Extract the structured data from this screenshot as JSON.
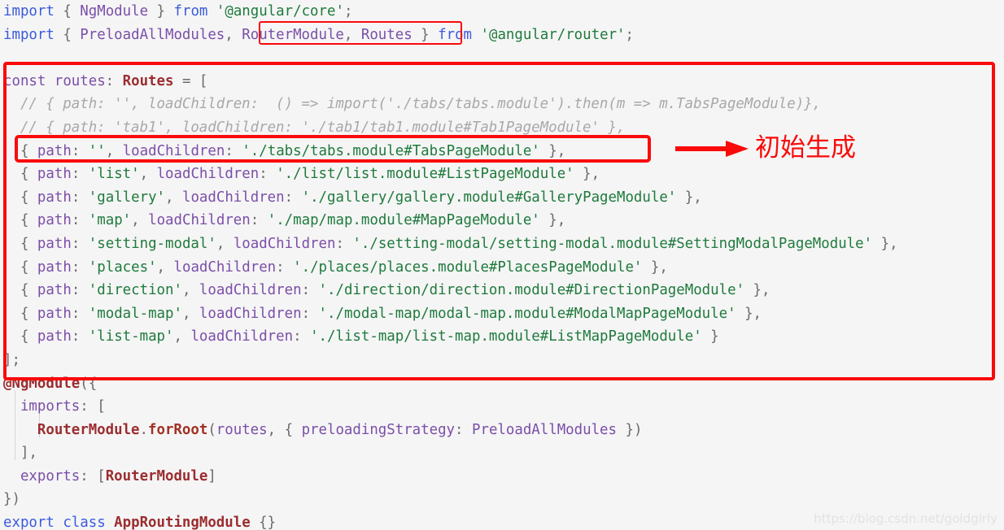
{
  "editor": {
    "language": "typescript",
    "background_color": "#f5f5f5",
    "lines": [
      {
        "n": 1,
        "tokens": [
          {
            "t": "import",
            "c": "kw"
          },
          {
            "t": " ",
            "c": "plain"
          },
          {
            "t": "{",
            "c": "punc"
          },
          {
            "t": " ",
            "c": "plain"
          },
          {
            "t": "NgModule",
            "c": "id"
          },
          {
            "t": " ",
            "c": "plain"
          },
          {
            "t": "}",
            "c": "punc"
          },
          {
            "t": " ",
            "c": "plain"
          },
          {
            "t": "from",
            "c": "kw"
          },
          {
            "t": " ",
            "c": "plain"
          },
          {
            "t": "'@angular/core'",
            "c": "str"
          },
          {
            "t": ";",
            "c": "punc"
          }
        ]
      },
      {
        "n": 2,
        "tokens": [
          {
            "t": "import",
            "c": "kw"
          },
          {
            "t": " ",
            "c": "plain"
          },
          {
            "t": "{",
            "c": "punc"
          },
          {
            "t": " ",
            "c": "plain"
          },
          {
            "t": "PreloadAllModules",
            "c": "id"
          },
          {
            "t": ",",
            "c": "punc"
          },
          {
            "t": " ",
            "c": "plain"
          },
          {
            "t": "RouterModule",
            "c": "id"
          },
          {
            "t": ",",
            "c": "punc"
          },
          {
            "t": " ",
            "c": "plain"
          },
          {
            "t": "Routes",
            "c": "id"
          },
          {
            "t": " ",
            "c": "plain"
          },
          {
            "t": "}",
            "c": "punc"
          },
          {
            "t": " ",
            "c": "plain"
          },
          {
            "t": "from",
            "c": "kw"
          },
          {
            "t": " ",
            "c": "plain"
          },
          {
            "t": "'@angular/router'",
            "c": "str"
          },
          {
            "t": ";",
            "c": "punc"
          }
        ]
      },
      {
        "n": 3,
        "tokens": []
      },
      {
        "n": 4,
        "tokens": [
          {
            "t": "const",
            "c": "id"
          },
          {
            "t": " ",
            "c": "plain"
          },
          {
            "t": "routes",
            "c": "id"
          },
          {
            "t": ":",
            "c": "punc"
          },
          {
            "t": " ",
            "c": "plain"
          },
          {
            "t": "Routes",
            "c": "type"
          },
          {
            "t": " ",
            "c": "plain"
          },
          {
            "t": "=",
            "c": "punc"
          },
          {
            "t": " ",
            "c": "plain"
          },
          {
            "t": "[",
            "c": "punc"
          }
        ]
      },
      {
        "n": 5,
        "tokens": [
          {
            "t": "  // { path: '', loadChildren:  () => import('./tabs/tabs.module').then(m => m.TabsPageModule)},",
            "c": "cmt"
          }
        ]
      },
      {
        "n": 6,
        "tokens": [
          {
            "t": "  // { path: 'tab1', loadChildren: './tab1/tab1.module#Tab1PageModule' },",
            "c": "cmt"
          }
        ]
      },
      {
        "n": 7,
        "tokens": [
          {
            "t": "  ",
            "c": "plain"
          },
          {
            "t": "{",
            "c": "punc"
          },
          {
            "t": " ",
            "c": "plain"
          },
          {
            "t": "path",
            "c": "id"
          },
          {
            "t": ":",
            "c": "punc"
          },
          {
            "t": " ",
            "c": "plain"
          },
          {
            "t": "''",
            "c": "str"
          },
          {
            "t": ",",
            "c": "punc"
          },
          {
            "t": " ",
            "c": "plain"
          },
          {
            "t": "loadChildren",
            "c": "id"
          },
          {
            "t": ":",
            "c": "punc"
          },
          {
            "t": " ",
            "c": "plain"
          },
          {
            "t": "'./tabs/tabs.module#TabsPageModule'",
            "c": "str"
          },
          {
            "t": " ",
            "c": "plain"
          },
          {
            "t": "}",
            "c": "punc"
          },
          {
            "t": ",",
            "c": "punc"
          }
        ]
      },
      {
        "n": 8,
        "tokens": [
          {
            "t": "  ",
            "c": "plain"
          },
          {
            "t": "{",
            "c": "punc"
          },
          {
            "t": " ",
            "c": "plain"
          },
          {
            "t": "path",
            "c": "id"
          },
          {
            "t": ":",
            "c": "punc"
          },
          {
            "t": " ",
            "c": "plain"
          },
          {
            "t": "'list'",
            "c": "str"
          },
          {
            "t": ",",
            "c": "punc"
          },
          {
            "t": " ",
            "c": "plain"
          },
          {
            "t": "loadChildren",
            "c": "id"
          },
          {
            "t": ":",
            "c": "punc"
          },
          {
            "t": " ",
            "c": "plain"
          },
          {
            "t": "'./list/list.module#ListPageModule'",
            "c": "str"
          },
          {
            "t": " ",
            "c": "plain"
          },
          {
            "t": "}",
            "c": "punc"
          },
          {
            "t": ",",
            "c": "punc"
          }
        ]
      },
      {
        "n": 9,
        "tokens": [
          {
            "t": "  ",
            "c": "plain"
          },
          {
            "t": "{",
            "c": "punc"
          },
          {
            "t": " ",
            "c": "plain"
          },
          {
            "t": "path",
            "c": "id"
          },
          {
            "t": ":",
            "c": "punc"
          },
          {
            "t": " ",
            "c": "plain"
          },
          {
            "t": "'gallery'",
            "c": "str"
          },
          {
            "t": ",",
            "c": "punc"
          },
          {
            "t": " ",
            "c": "plain"
          },
          {
            "t": "loadChildren",
            "c": "id"
          },
          {
            "t": ":",
            "c": "punc"
          },
          {
            "t": " ",
            "c": "plain"
          },
          {
            "t": "'./gallery/gallery.module#GalleryPageModule'",
            "c": "str"
          },
          {
            "t": " ",
            "c": "plain"
          },
          {
            "t": "}",
            "c": "punc"
          },
          {
            "t": ",",
            "c": "punc"
          }
        ]
      },
      {
        "n": 10,
        "tokens": [
          {
            "t": "  ",
            "c": "plain"
          },
          {
            "t": "{",
            "c": "punc"
          },
          {
            "t": " ",
            "c": "plain"
          },
          {
            "t": "path",
            "c": "id"
          },
          {
            "t": ":",
            "c": "punc"
          },
          {
            "t": " ",
            "c": "plain"
          },
          {
            "t": "'map'",
            "c": "str"
          },
          {
            "t": ",",
            "c": "punc"
          },
          {
            "t": " ",
            "c": "plain"
          },
          {
            "t": "loadChildren",
            "c": "id"
          },
          {
            "t": ":",
            "c": "punc"
          },
          {
            "t": " ",
            "c": "plain"
          },
          {
            "t": "'./map/map.module#MapPageModule'",
            "c": "str"
          },
          {
            "t": " ",
            "c": "plain"
          },
          {
            "t": "}",
            "c": "punc"
          },
          {
            "t": ",",
            "c": "punc"
          }
        ]
      },
      {
        "n": 11,
        "tokens": [
          {
            "t": "  ",
            "c": "plain"
          },
          {
            "t": "{",
            "c": "punc"
          },
          {
            "t": " ",
            "c": "plain"
          },
          {
            "t": "path",
            "c": "id"
          },
          {
            "t": ":",
            "c": "punc"
          },
          {
            "t": " ",
            "c": "plain"
          },
          {
            "t": "'setting-modal'",
            "c": "str"
          },
          {
            "t": ",",
            "c": "punc"
          },
          {
            "t": " ",
            "c": "plain"
          },
          {
            "t": "loadChildren",
            "c": "id"
          },
          {
            "t": ":",
            "c": "punc"
          },
          {
            "t": " ",
            "c": "plain"
          },
          {
            "t": "'./setting-modal/setting-modal.module#SettingModalPageModule'",
            "c": "str"
          },
          {
            "t": " ",
            "c": "plain"
          },
          {
            "t": "}",
            "c": "punc"
          },
          {
            "t": ",",
            "c": "punc"
          }
        ]
      },
      {
        "n": 12,
        "tokens": [
          {
            "t": "  ",
            "c": "plain"
          },
          {
            "t": "{",
            "c": "punc"
          },
          {
            "t": " ",
            "c": "plain"
          },
          {
            "t": "path",
            "c": "id"
          },
          {
            "t": ":",
            "c": "punc"
          },
          {
            "t": " ",
            "c": "plain"
          },
          {
            "t": "'places'",
            "c": "str"
          },
          {
            "t": ",",
            "c": "punc"
          },
          {
            "t": " ",
            "c": "plain"
          },
          {
            "t": "loadChildren",
            "c": "id"
          },
          {
            "t": ":",
            "c": "punc"
          },
          {
            "t": " ",
            "c": "plain"
          },
          {
            "t": "'./places/places.module#PlacesPageModule'",
            "c": "str"
          },
          {
            "t": " ",
            "c": "plain"
          },
          {
            "t": "}",
            "c": "punc"
          },
          {
            "t": ",",
            "c": "punc"
          }
        ]
      },
      {
        "n": 13,
        "tokens": [
          {
            "t": "  ",
            "c": "plain"
          },
          {
            "t": "{",
            "c": "punc"
          },
          {
            "t": " ",
            "c": "plain"
          },
          {
            "t": "path",
            "c": "id"
          },
          {
            "t": ":",
            "c": "punc"
          },
          {
            "t": " ",
            "c": "plain"
          },
          {
            "t": "'direction'",
            "c": "str"
          },
          {
            "t": ",",
            "c": "punc"
          },
          {
            "t": " ",
            "c": "plain"
          },
          {
            "t": "loadChildren",
            "c": "id"
          },
          {
            "t": ":",
            "c": "punc"
          },
          {
            "t": " ",
            "c": "plain"
          },
          {
            "t": "'./direction/direction.module#DirectionPageModule'",
            "c": "str"
          },
          {
            "t": " ",
            "c": "plain"
          },
          {
            "t": "}",
            "c": "punc"
          },
          {
            "t": ",",
            "c": "punc"
          }
        ]
      },
      {
        "n": 14,
        "tokens": [
          {
            "t": "  ",
            "c": "plain"
          },
          {
            "t": "{",
            "c": "punc"
          },
          {
            "t": " ",
            "c": "plain"
          },
          {
            "t": "path",
            "c": "id"
          },
          {
            "t": ":",
            "c": "punc"
          },
          {
            "t": " ",
            "c": "plain"
          },
          {
            "t": "'modal-map'",
            "c": "str"
          },
          {
            "t": ",",
            "c": "punc"
          },
          {
            "t": " ",
            "c": "plain"
          },
          {
            "t": "loadChildren",
            "c": "id"
          },
          {
            "t": ":",
            "c": "punc"
          },
          {
            "t": " ",
            "c": "plain"
          },
          {
            "t": "'./modal-map/modal-map.module#ModalMapPageModule'",
            "c": "str"
          },
          {
            "t": " ",
            "c": "plain"
          },
          {
            "t": "}",
            "c": "punc"
          },
          {
            "t": ",",
            "c": "punc"
          }
        ]
      },
      {
        "n": 15,
        "tokens": [
          {
            "t": "  ",
            "c": "plain"
          },
          {
            "t": "{",
            "c": "punc"
          },
          {
            "t": " ",
            "c": "plain"
          },
          {
            "t": "path",
            "c": "id"
          },
          {
            "t": ":",
            "c": "punc"
          },
          {
            "t": " ",
            "c": "plain"
          },
          {
            "t": "'list-map'",
            "c": "str"
          },
          {
            "t": ",",
            "c": "punc"
          },
          {
            "t": " ",
            "c": "plain"
          },
          {
            "t": "loadChildren",
            "c": "id"
          },
          {
            "t": ":",
            "c": "punc"
          },
          {
            "t": " ",
            "c": "plain"
          },
          {
            "t": "'./list-map/list-map.module#ListMapPageModule'",
            "c": "str"
          },
          {
            "t": " ",
            "c": "plain"
          },
          {
            "t": "}",
            "c": "punc"
          }
        ]
      },
      {
        "n": 16,
        "tokens": [
          {
            "t": "]",
            "c": "punc"
          },
          {
            "t": ";",
            "c": "punc"
          }
        ]
      },
      {
        "n": 17,
        "tokens": [
          {
            "t": "@NgModule",
            "c": "type"
          },
          {
            "t": "(",
            "c": "punc"
          },
          {
            "t": "{",
            "c": "punc"
          }
        ]
      },
      {
        "n": 18,
        "tokens": [
          {
            "t": "  ",
            "c": "plain"
          },
          {
            "t": "imports",
            "c": "id"
          },
          {
            "t": ":",
            "c": "punc"
          },
          {
            "t": " ",
            "c": "plain"
          },
          {
            "t": "[",
            "c": "punc"
          }
        ]
      },
      {
        "n": 19,
        "tokens": [
          {
            "t": "    ",
            "c": "plain"
          },
          {
            "t": "RouterModule",
            "c": "type"
          },
          {
            "t": ".",
            "c": "punc"
          },
          {
            "t": "forRoot",
            "c": "fn"
          },
          {
            "t": "(",
            "c": "punc"
          },
          {
            "t": "routes",
            "c": "id"
          },
          {
            "t": ",",
            "c": "punc"
          },
          {
            "t": " ",
            "c": "plain"
          },
          {
            "t": "{",
            "c": "punc"
          },
          {
            "t": " ",
            "c": "plain"
          },
          {
            "t": "preloadingStrategy",
            "c": "id"
          },
          {
            "t": ":",
            "c": "punc"
          },
          {
            "t": " ",
            "c": "plain"
          },
          {
            "t": "PreloadAllModules",
            "c": "id"
          },
          {
            "t": " ",
            "c": "plain"
          },
          {
            "t": "}",
            "c": "punc"
          },
          {
            "t": ")",
            "c": "punc"
          }
        ]
      },
      {
        "n": 20,
        "tokens": [
          {
            "t": "  ",
            "c": "plain"
          },
          {
            "t": "]",
            "c": "punc"
          },
          {
            "t": ",",
            "c": "punc"
          }
        ]
      },
      {
        "n": 21,
        "tokens": [
          {
            "t": "  ",
            "c": "plain"
          },
          {
            "t": "exports",
            "c": "id"
          },
          {
            "t": ":",
            "c": "punc"
          },
          {
            "t": " ",
            "c": "plain"
          },
          {
            "t": "[",
            "c": "punc"
          },
          {
            "t": "RouterModule",
            "c": "type"
          },
          {
            "t": "]",
            "c": "punc"
          }
        ]
      },
      {
        "n": 22,
        "tokens": [
          {
            "t": "}",
            "c": "punc"
          },
          {
            "t": ")",
            "c": "punc"
          }
        ]
      },
      {
        "n": 23,
        "tokens": [
          {
            "t": "export",
            "c": "kw"
          },
          {
            "t": " ",
            "c": "plain"
          },
          {
            "t": "class",
            "c": "kw"
          },
          {
            "t": " ",
            "c": "plain"
          },
          {
            "t": "AppRoutingModule",
            "c": "type"
          },
          {
            "t": " ",
            "c": "plain"
          },
          {
            "t": "{",
            "c": "punc"
          },
          {
            "t": "}",
            "c": "punc"
          }
        ]
      }
    ]
  },
  "annotations": {
    "color": "#fa0a0a",
    "label_text": "初始生成",
    "import_box_target": "RouterModule, Routes",
    "block_box_target": "const routes: Routes = [ ... ];",
    "line_box_target": "{ path: '', loadChildren: './tabs/tabs.module#TabsPageModule' },"
  },
  "watermark": {
    "text": "https://blog.csdn.net/goldgirly"
  }
}
